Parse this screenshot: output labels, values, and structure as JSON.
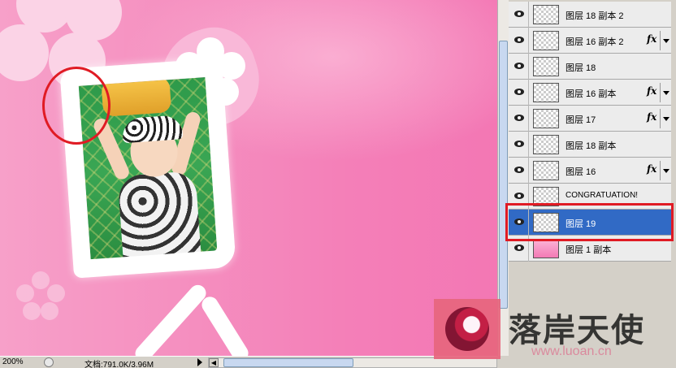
{
  "status_bar": {
    "zoom": "200%",
    "document_size": "文档:791.0K/3.96M"
  },
  "layers": [
    {
      "name": "图层 18 副本 2",
      "fx": ""
    },
    {
      "name": "图层 16 副本 2",
      "fx": "fx"
    },
    {
      "name": "图层 18",
      "fx": ""
    },
    {
      "name": "图层 16 副本",
      "fx": "fx"
    },
    {
      "name": "图层 17",
      "fx": "fx"
    },
    {
      "name": "图层 18 副本",
      "fx": ""
    },
    {
      "name": "图层 16",
      "fx": "fx"
    },
    {
      "name": "CONGRATUATION!",
      "fx": ""
    },
    {
      "name": "图层 19",
      "fx": "",
      "selected": true
    },
    {
      "name": "图层 1 副本",
      "fx": ""
    }
  ],
  "watermark": {
    "title": "落岸天使",
    "url": "www.luoan.cn"
  },
  "colors": {
    "canvas_pink": "#f47fb8",
    "selection_blue": "#316ac5",
    "highlight_red": "#e01b24"
  }
}
